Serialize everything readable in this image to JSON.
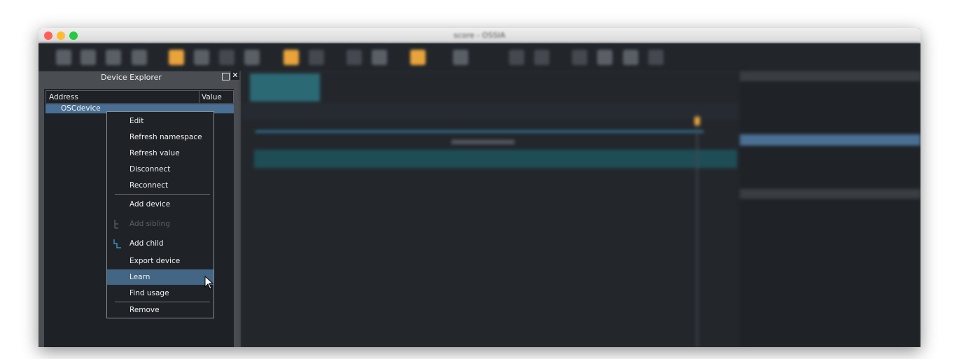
{
  "window": {
    "title": "score - OSSIA"
  },
  "device_explorer": {
    "title": "Device Explorer",
    "float_icon": "float-window-icon",
    "close_glyph": "✕",
    "columns": {
      "address": "Address",
      "value": "Value"
    },
    "rows": [
      {
        "label": "OSCdevice"
      }
    ]
  },
  "context_menu": {
    "items": [
      {
        "label": "Edit",
        "enabled": true
      },
      {
        "label": "Refresh namespace",
        "enabled": true
      },
      {
        "label": "Refresh value",
        "enabled": true
      },
      {
        "label": "Disconnect",
        "enabled": true
      },
      {
        "label": "Reconnect",
        "enabled": true
      },
      {
        "label": "Add device",
        "enabled": true
      },
      {
        "label": "Add sibling",
        "enabled": false,
        "icon": "add-sibling-icon"
      },
      {
        "label": "Add child",
        "enabled": true,
        "icon": "add-child-icon"
      },
      {
        "label": "Export device",
        "enabled": true
      },
      {
        "label": "Learn",
        "enabled": true,
        "highlighted": true
      },
      {
        "label": "Find usage",
        "enabled": true
      },
      {
        "label": "Remove",
        "enabled": true
      }
    ]
  },
  "colors": {
    "accent": "#e8a33a",
    "selection": "#4a6f94",
    "menu_highlight": "#436684",
    "child_icon": "#3aa6d9"
  }
}
